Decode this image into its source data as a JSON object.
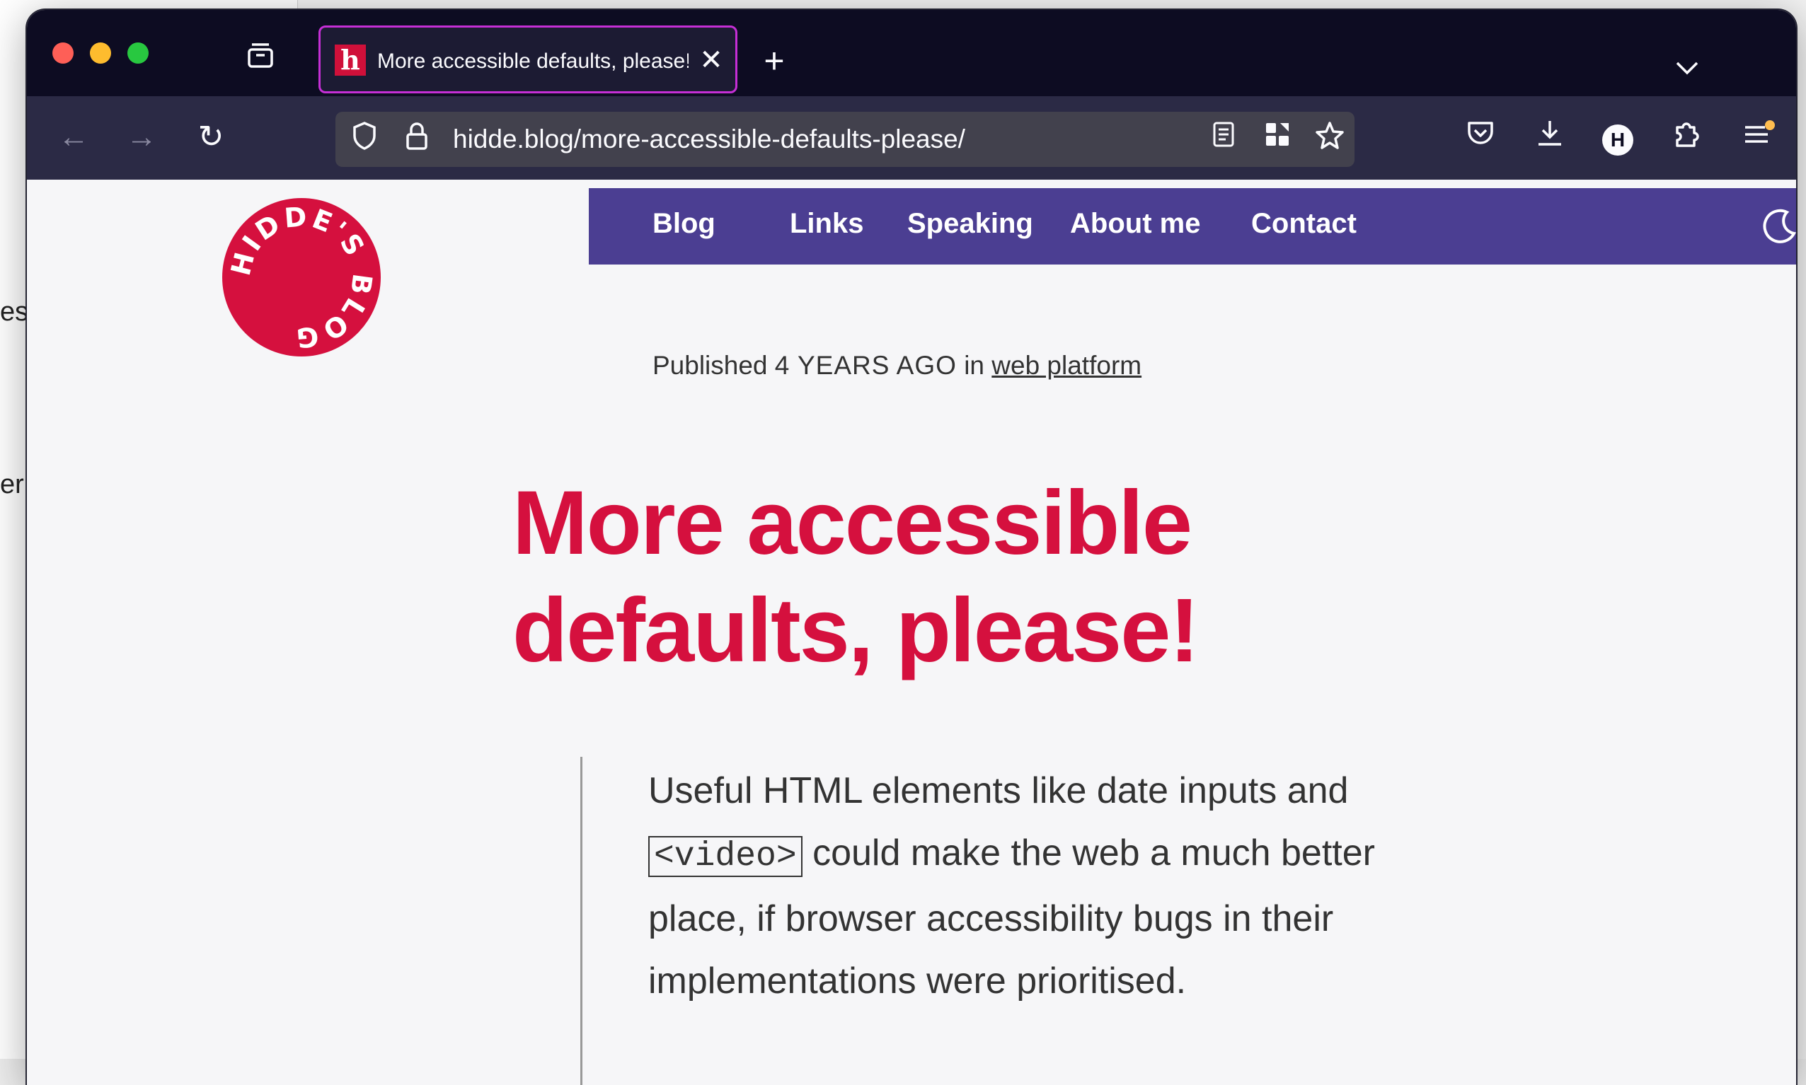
{
  "background_window": {
    "fragments": [
      "es",
      "er"
    ]
  },
  "tab": {
    "favicon_letter": "h",
    "title": "More accessible defaults, please!",
    "close_glyph": "✕"
  },
  "toolbar": {
    "new_tab_glyph": "+",
    "tab_list_glyph": "⌄",
    "back_glyph": "←",
    "forward_glyph": "→",
    "reload_glyph": "↻",
    "url": "hidde.blog/more-accessible-defaults-please/",
    "account_initial": "H"
  },
  "site": {
    "nav": [
      "Blog",
      "Links",
      "Speaking",
      "About me",
      "Contact"
    ],
    "logo_text": "HIDDE'S BLOG",
    "logo_color": "#d5103e",
    "nav_color": "#4b3e92"
  },
  "article": {
    "published_prefix": "Published",
    "published_age": "4 YEARS AGO",
    "published_in": "in",
    "category": "web platform",
    "title_line1": "More accessible",
    "title_line2": "defaults, please!",
    "intro_before": "Useful HTML elements like date inputs and",
    "intro_code": "<video>",
    "intro_after": "could make the web a much better place, if browser accessibility bugs in their implementations were prioritised."
  },
  "colors": {
    "tabstrip": "#0d0c22",
    "navbar": "#2b2a45",
    "tab_border": "#c52fd6",
    "headline": "#d5103e"
  }
}
